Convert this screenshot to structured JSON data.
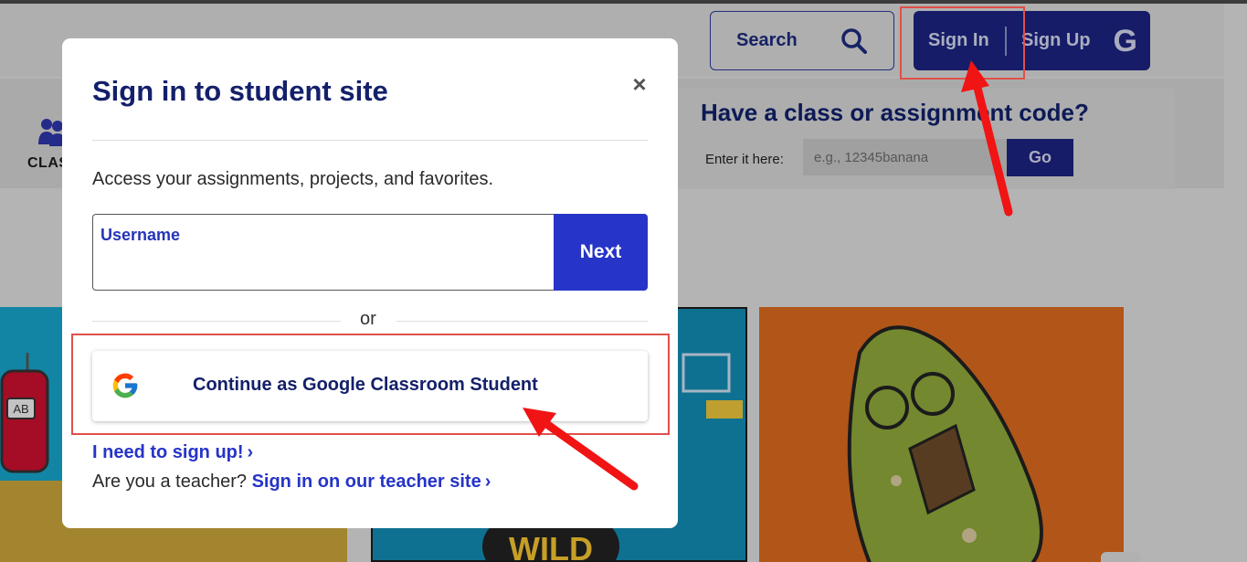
{
  "header": {
    "search_label": "Search",
    "search_icon": "magnifier-icon",
    "signin_label": "Sign In",
    "signup_label": "Sign Up",
    "google_glyph": "G"
  },
  "subnav": {
    "class_label": "CLAS",
    "code_title": "Have a class or assignment code?",
    "code_prompt": "Enter it here:",
    "code_placeholder": "e.g., 12345banana",
    "go_label": "Go"
  },
  "modal": {
    "title": "Sign in to student site",
    "close_label": "×",
    "description": "Access your assignments, projects, and favorites.",
    "username_label": "Username",
    "username_value": "",
    "next_label": "Next",
    "or_text": "or",
    "google_button_label": "Continue as Google Classroom Student",
    "signup_link": "I need to sign up!",
    "teacher_prompt": "Are you a teacher?",
    "teacher_link": "Sign in on our teacher site",
    "chevron": "›"
  },
  "colors": {
    "brand_navy": "#1c237e",
    "link_blue": "#2634c7",
    "annotation_red": "#e0504a",
    "arrow_red": "#f01414"
  }
}
